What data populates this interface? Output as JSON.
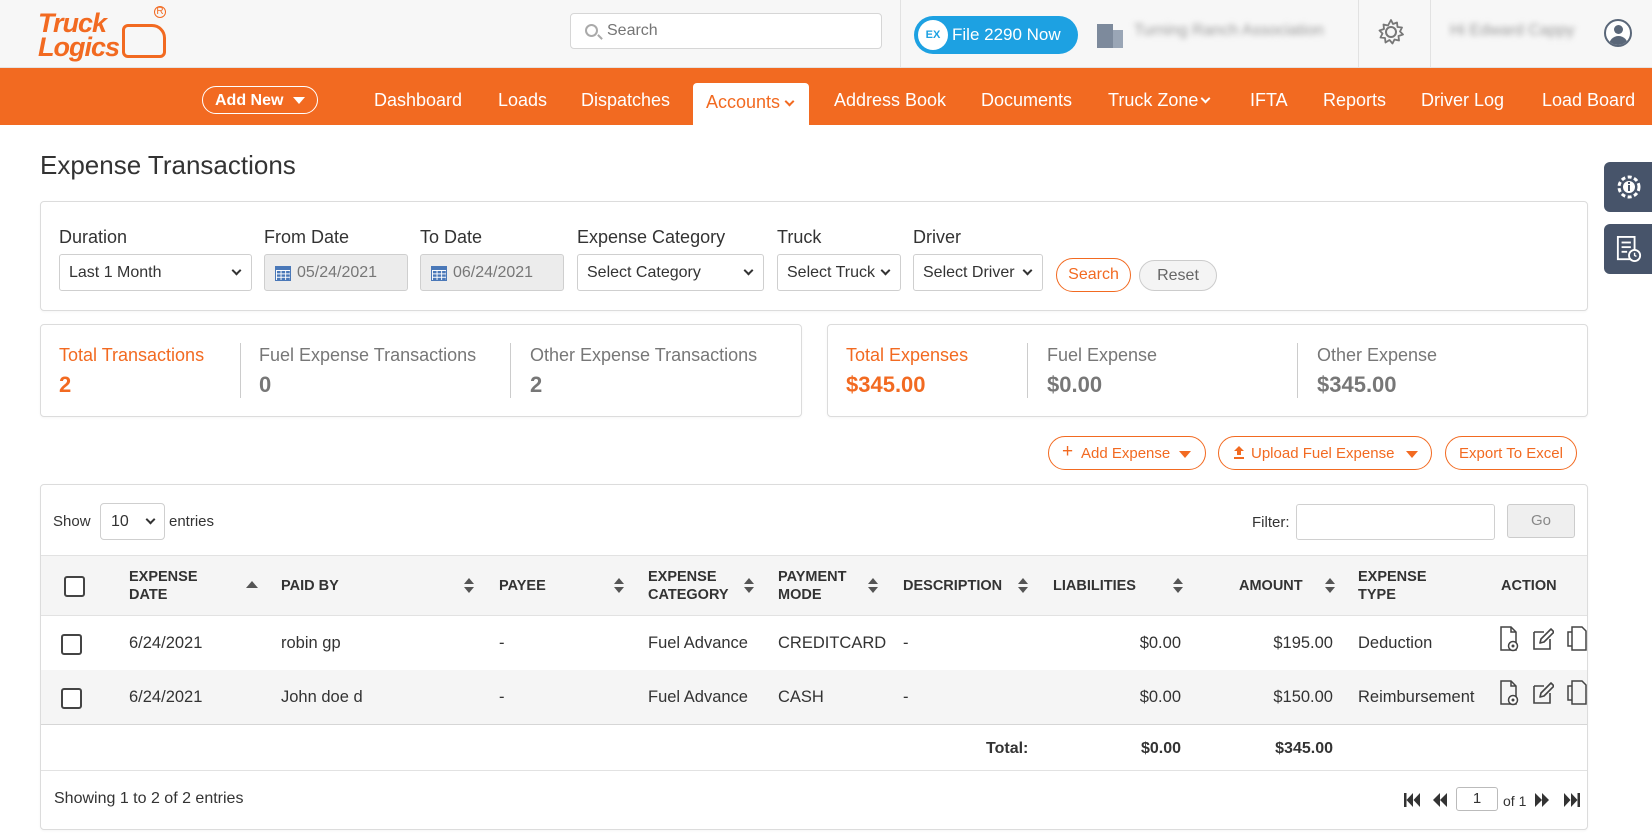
{
  "header": {
    "logo_line1": "Truck",
    "logo_line2": "Logics",
    "search_placeholder": "Search",
    "file_button": "File 2290 Now",
    "file_badge": "EX",
    "org_name": "Turning Ranch Association",
    "user_name": "Hi Edward Cappy"
  },
  "nav": {
    "add_new": "Add New",
    "items": [
      "Dashboard",
      "Loads",
      "Dispatches",
      "Accounts",
      "Address Book",
      "Documents",
      "Truck Zone",
      "IFTA",
      "Reports",
      "Driver Log",
      "Load Board"
    ],
    "active": "Accounts"
  },
  "page": {
    "title": "Expense Transactions"
  },
  "filters": {
    "duration_label": "Duration",
    "duration_value": "Last 1 Month",
    "from_label": "From Date",
    "from_value": "05/24/2021",
    "to_label": "To Date",
    "to_value": "06/24/2021",
    "category_label": "Expense Category",
    "category_value": "Select Category",
    "truck_label": "Truck",
    "truck_value": "Select Truck",
    "driver_label": "Driver",
    "driver_value": "Select Driver",
    "search_button": "Search",
    "reset_button": "Reset"
  },
  "stats": {
    "total_tx_label": "Total Transactions",
    "total_tx_value": "2",
    "fuel_tx_label": "Fuel Expense Transactions",
    "fuel_tx_value": "0",
    "other_tx_label": "Other Expense Transactions",
    "other_tx_value": "2",
    "total_exp_label": "Total Expenses",
    "total_exp_value": "$345.00",
    "fuel_exp_label": "Fuel Expense",
    "fuel_exp_value": "$0.00",
    "other_exp_label": "Other Expense",
    "other_exp_value": "$345.00"
  },
  "actions": {
    "add_expense": "Add Expense",
    "upload_fuel": "Upload Fuel Expense",
    "export_excel": "Export To Excel"
  },
  "table": {
    "show_label": "Show",
    "entries_value": "10",
    "entries_label": "entries",
    "filter_label": "Filter:",
    "go_button": "Go",
    "columns": {
      "expense_date": "EXPENSE DATE",
      "paid_by": "PAID BY",
      "payee": "PAYEE",
      "expense_category": "EXPENSE CATEGORY",
      "payment_mode": "PAYMENT MODE",
      "description": "DESCRIPTION",
      "liabilities": "LIABILITIES",
      "amount": "AMOUNT",
      "expense_type": "EXPENSE TYPE",
      "action": "ACTION"
    },
    "rows": [
      {
        "date": "6/24/2021",
        "paid_by": "robin gp",
        "payee": "-",
        "category": "Fuel Advance",
        "mode": "CREDITCARD",
        "description": "-",
        "liabilities": "$0.00",
        "amount": "$195.00",
        "type": "Deduction"
      },
      {
        "date": "6/24/2021",
        "paid_by": "John doe d",
        "payee": "-",
        "category": "Fuel Advance",
        "mode": "CASH",
        "description": "-",
        "liabilities": "$0.00",
        "amount": "$150.00",
        "type": "Reimbursement"
      }
    ],
    "total_label": "Total:",
    "total_liabilities": "$0.00",
    "total_amount": "$345.00",
    "showing": "Showing 1 to 2 of 2 entries",
    "page_value": "1",
    "page_of": "of 1"
  },
  "colors": {
    "brand": "#f26a21",
    "file_button": "#1da1e2",
    "side_tab": "#47546a"
  }
}
